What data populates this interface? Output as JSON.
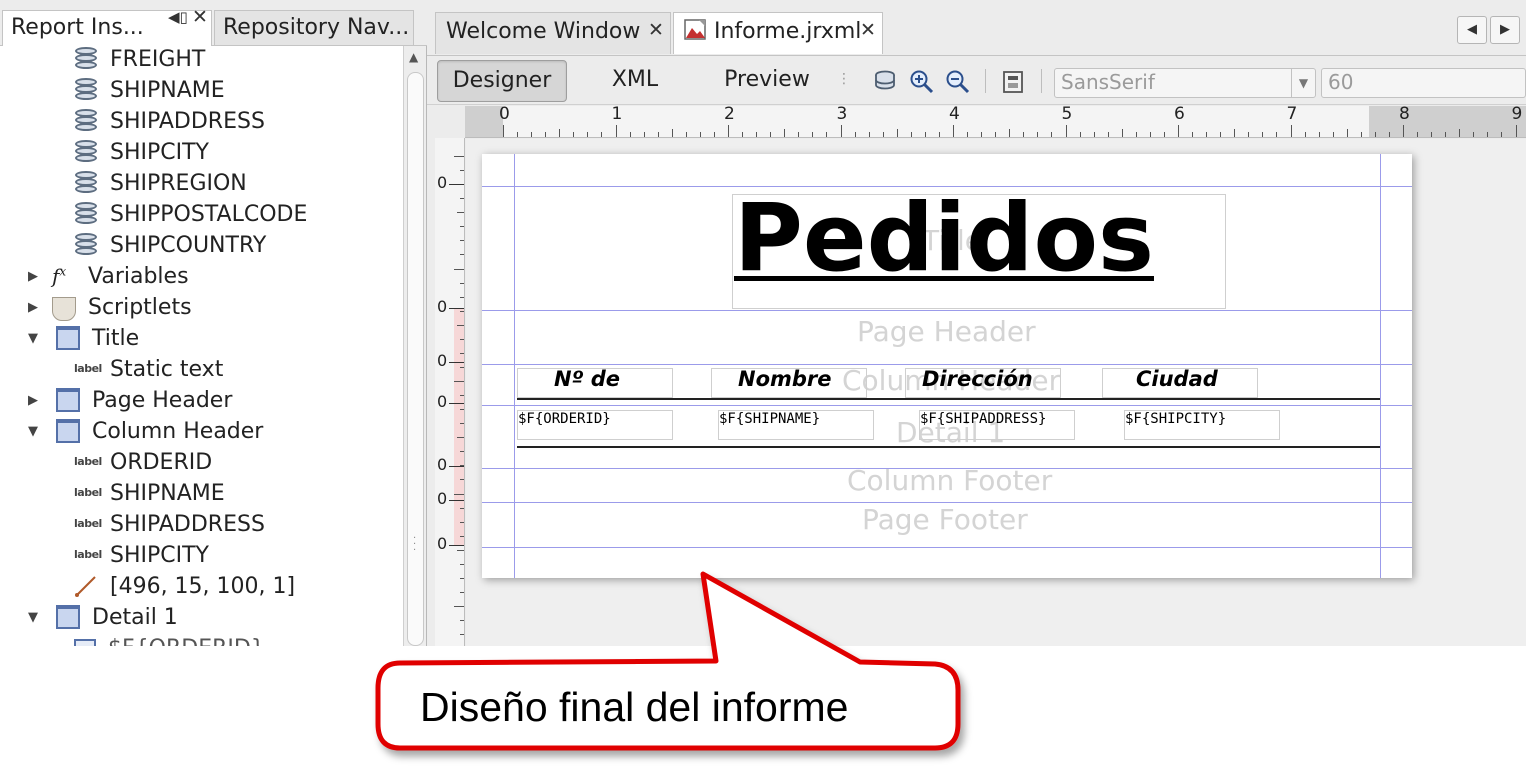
{
  "left_panel": {
    "tabs": [
      {
        "label": "Report Ins..."
      },
      {
        "label": "Repository Nav..."
      }
    ],
    "tree": [
      {
        "label": "FREIGHT",
        "icon": "field-icon"
      },
      {
        "label": "SHIPNAME",
        "icon": "field-icon"
      },
      {
        "label": "SHIPADDRESS",
        "icon": "field-icon"
      },
      {
        "label": "SHIPCITY",
        "icon": "field-icon"
      },
      {
        "label": "SHIPREGION",
        "icon": "field-icon"
      },
      {
        "label": "SHIPPOSTALCODE",
        "icon": "field-icon"
      },
      {
        "label": "SHIPCOUNTRY",
        "icon": "field-icon"
      },
      {
        "label": "Variables",
        "icon": "fx-icon",
        "state": "collapsed"
      },
      {
        "label": "Scriptlets",
        "icon": "coffee-icon",
        "state": "collapsed"
      },
      {
        "label": "Title",
        "icon": "band-icon",
        "state": "expanded"
      },
      {
        "label": "Static text",
        "icon": "label-icon"
      },
      {
        "label": "Page Header",
        "icon": "band-icon",
        "state": "collapsed"
      },
      {
        "label": "Column Header",
        "icon": "band-icon",
        "state": "expanded"
      },
      {
        "label": "ORDERID",
        "icon": "label-icon"
      },
      {
        "label": "SHIPNAME",
        "icon": "label-icon"
      },
      {
        "label": "SHIPADDRESS",
        "icon": "label-icon"
      },
      {
        "label": "SHIPCITY",
        "icon": "label-icon"
      },
      {
        "label": "[496, 15, 100, 1]",
        "icon": "line-icon"
      },
      {
        "label": "Detail 1",
        "icon": "band-icon",
        "state": "expanded"
      },
      {
        "label": "$F{ORDERID}",
        "icon": "textfield-icon"
      }
    ]
  },
  "editor": {
    "tabs": [
      {
        "label": "Welcome Window"
      },
      {
        "label": "Informe.jrxml"
      }
    ],
    "modes": [
      "Designer",
      "XML",
      "Preview"
    ],
    "active_mode": "Designer",
    "font_name": "SansSerif",
    "font_size": "60",
    "ruler_h": [
      "0",
      "1",
      "2",
      "3",
      "4",
      "5",
      "6",
      "7",
      "8",
      "9"
    ],
    "ruler_v": [
      "0",
      "0",
      "0",
      "0",
      "0",
      "0",
      "0"
    ]
  },
  "report": {
    "title": "Pedidos",
    "title_band_label": "Title",
    "bands": [
      "Page Header",
      "Column Header",
      "Detail 1",
      "Column Footer",
      "Page Footer"
    ],
    "column_headers": [
      "Nº de",
      "Nombre",
      "Dirección",
      "Ciudad"
    ],
    "detail_fields": [
      "$F{ORDERID}",
      "$F{SHIPNAME}",
      "$F{SHIPADDRESS}",
      "$F{SHIPCITY}"
    ]
  },
  "callout": {
    "text": "Diseño final del informe",
    "stroke_color": "#e00000"
  }
}
